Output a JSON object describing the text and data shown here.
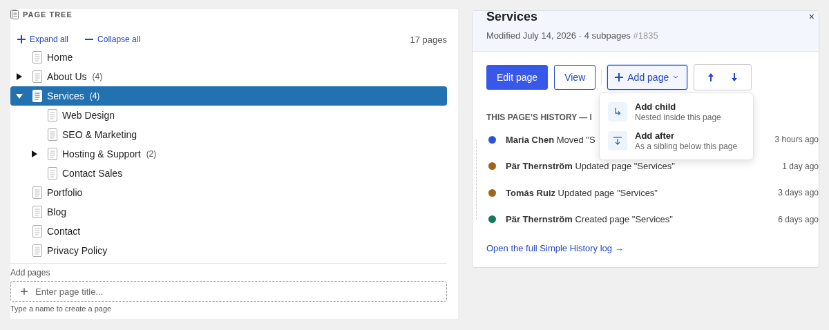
{
  "page_tree": {
    "title": "PAGE TREE",
    "expand_all": "Expand all",
    "collapse_all": "Collapse all",
    "count": "17 pages",
    "items": [
      {
        "label": "Home",
        "selected": false
      },
      {
        "label": "About Us",
        "count": "(4)",
        "expanded": false,
        "selected": false
      },
      {
        "label": "Services",
        "count": "(4)",
        "expanded": true,
        "selected": true,
        "children": [
          {
            "label": "Web Design",
            "selected": false
          },
          {
            "label": "SEO & Marketing",
            "selected": false
          },
          {
            "label": "Hosting & Support",
            "count": "(2)",
            "expanded": false,
            "selected": false
          },
          {
            "label": "Contact Sales",
            "selected": false
          }
        ]
      },
      {
        "label": "Portfolio",
        "selected": false
      },
      {
        "label": "Blog",
        "selected": false
      },
      {
        "label": "Contact",
        "selected": false
      },
      {
        "label": "Privacy Policy",
        "selected": false
      }
    ],
    "add_pages": {
      "label": "Add pages",
      "placeholder": "Enter page title...",
      "hint": "Type a name to create a page"
    }
  },
  "details": {
    "title": "Services",
    "meta": "Modified July 14, 2026 · 4 subpages",
    "id": "#1835",
    "close": "×",
    "buttons": {
      "edit": "Edit page",
      "view": "View",
      "add_page": {
        "label": "Add page",
        "expanded": true,
        "menu": [
          {
            "kind": "child",
            "title": "Add child",
            "description": "Nested inside this page"
          },
          {
            "kind": "after",
            "title": "Add after",
            "description": "As a sibling below this page"
          }
        ]
      }
    },
    "history": {
      "heading": "THIS PAGE’S HISTORY — l",
      "events": [
        {
          "text": "**Maria Chen** Moved \"S",
          "time": "3 hours ago",
          "color": "#2c55d4"
        },
        {
          "text": "**Pär Thernström** Updated page \"Services\"",
          "time": "1 day ago",
          "color": "#a0641a"
        },
        {
          "text": "**Tomás Ruiz** Updated page \"Services\"",
          "time": "3 days ago",
          "color": "#a0641a"
        },
        {
          "text": "**Pär Thernström** Created page \"Services\"",
          "time": "6 days ago",
          "color": "#157a57"
        }
      ],
      "link": "Open the full Simple History log →"
    }
  }
}
